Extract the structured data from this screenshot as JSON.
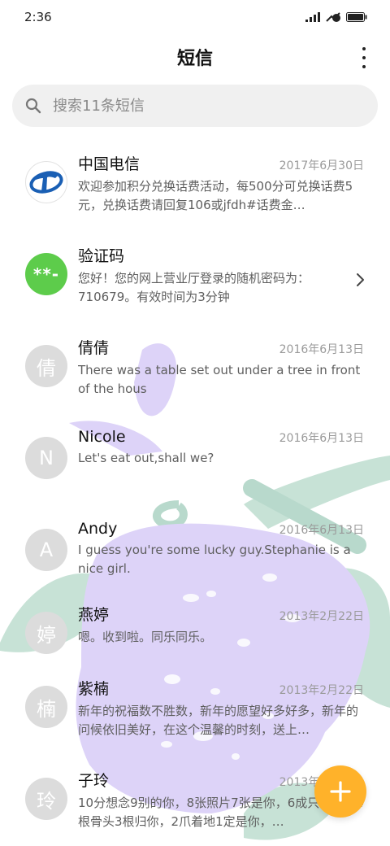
{
  "status_bar": {
    "time": "2:36"
  },
  "header": {
    "title": "短信",
    "more_icon": "more-vertical-icon"
  },
  "search": {
    "placeholder": "搜索11条短信",
    "icon": "search-icon"
  },
  "messages": [
    {
      "avatar": "",
      "avatar_type": "telecom-logo",
      "name": "中国电信",
      "date": "2017年6月30日",
      "preview": "欢迎参加积分兑换话费活动，每500分可兑换话费5元，兑换话费请回复106或jfdh#话费金…"
    },
    {
      "avatar": "**-",
      "avatar_type": "code",
      "name": "验证码",
      "date": "",
      "preview": "您好！您的网上营业厅登录的随机密码为：710679。有效时间为3分钟"
    },
    {
      "avatar": "倩",
      "avatar_type": "letter",
      "name": "倩倩",
      "date": "2016年6月13日",
      "preview": "There was a table set out under a tree in front of the hous"
    },
    {
      "avatar": "N",
      "avatar_type": "letter",
      "name": "Nicole",
      "date": "2016年6月13日",
      "preview": "Let's eat out,shall we?"
    },
    {
      "avatar": "A",
      "avatar_type": "letter",
      "name": "Andy",
      "date": "2016年6月13日",
      "preview": "I guess you're some lucky guy.Stephanie is a nice girl."
    },
    {
      "avatar": "婷",
      "avatar_type": "letter",
      "name": "燕婷",
      "date": "2013年2月22日",
      "preview": "嗯。收到啦。同乐同乐。"
    },
    {
      "avatar": "楠",
      "avatar_type": "letter",
      "name": "紫楠",
      "date": "2013年2月22日",
      "preview": "新年的祝福数不胜数，新年的愿望好多好多，新年的问候依旧美好，在这个温馨的时刻，送上…"
    },
    {
      "avatar": "玲",
      "avatar_type": "letter",
      "name": "子玲",
      "date": "2013年2月22日",
      "preview": "10分想念9别的你，8张照片7张是你，6成只像你，4根骨头3根归你，2爪着地1定是你，…"
    }
  ],
  "fab": {
    "icon": "plus-icon",
    "color": "#ffb22a"
  },
  "colors": {
    "code_avatar": "#5dcc4b",
    "telecom_blue": "#1a5fb4",
    "wallpaper_purple": "#d9cdf7",
    "wallpaper_green": "#b9d9cd"
  }
}
